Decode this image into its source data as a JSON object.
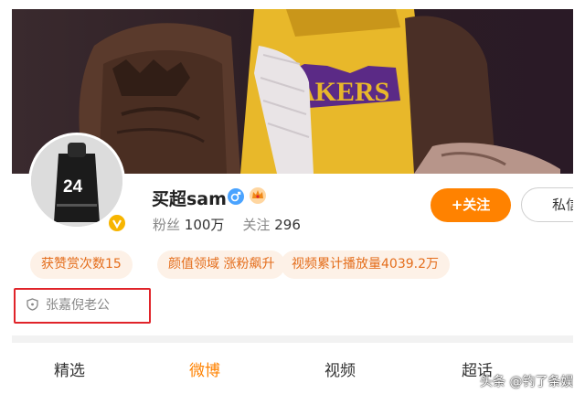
{
  "profile": {
    "username": "买超sam",
    "gender_icon": "male-icon",
    "member_icon": "crown-badge-icon",
    "verified_icon": "verified-v-icon",
    "followers_label": "粉丝",
    "followers_value": "100万",
    "following_label": "关注",
    "following_value": "296"
  },
  "actions": {
    "follow_label": "+关注",
    "message_label": "私信"
  },
  "tags": [
    {
      "label": "获赞赏次数15"
    },
    {
      "label": "颜值领域 涨粉飙升"
    },
    {
      "label": "视频累计播放量4039.2万"
    }
  ],
  "verification": {
    "icon": "shield-icon",
    "label": "张嘉倪老公"
  },
  "tabs": [
    {
      "label": "精选",
      "active": false
    },
    {
      "label": "微博",
      "active": true
    },
    {
      "label": "视频",
      "active": false
    },
    {
      "label": "超话",
      "active": false
    }
  ],
  "avatar": {
    "jersey_number": "24"
  },
  "watermark": "头条 @钓了条娱",
  "colors": {
    "accent": "#ff8200",
    "tag_bg": "#fdf1e7",
    "tag_text": "#e46d1b",
    "highlight_box": "#e0242a"
  }
}
